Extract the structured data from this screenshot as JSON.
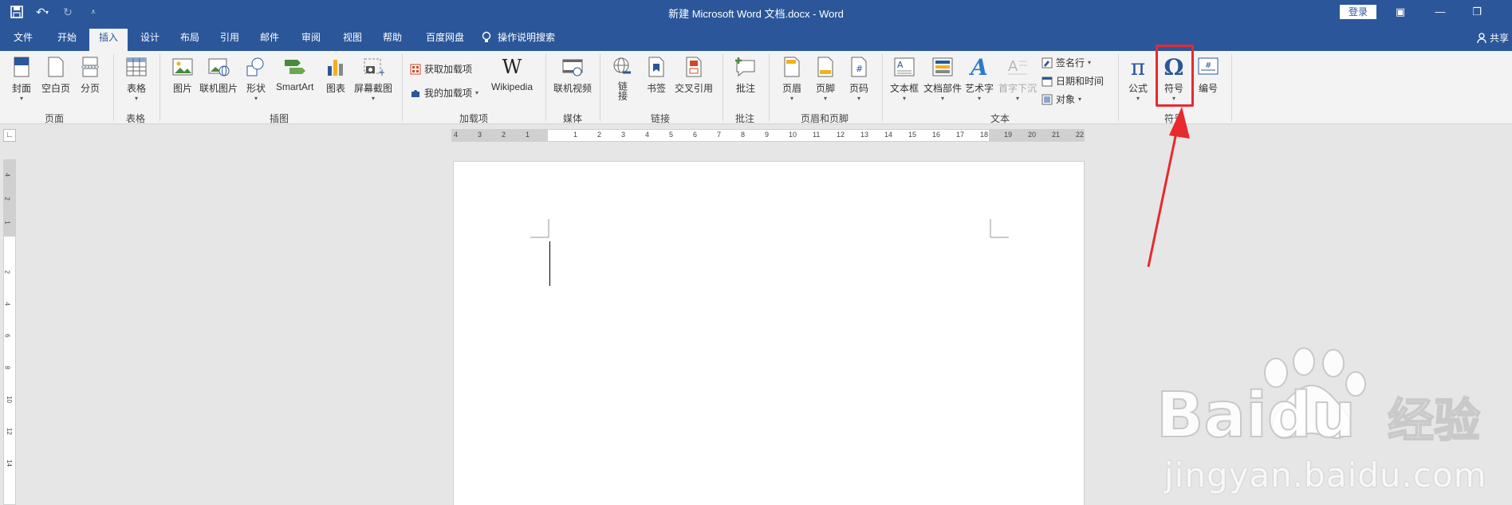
{
  "titlebar": {
    "title": "新建 Microsoft Word 文档.docx  -  Word",
    "login": "登录"
  },
  "tabs": [
    "文件",
    "开始",
    "插入",
    "设计",
    "布局",
    "引用",
    "邮件",
    "审阅",
    "视图",
    "帮助",
    "百度网盘"
  ],
  "active_tab": "插入",
  "tell_me": "操作说明搜索",
  "share": "共享",
  "ribbon": {
    "pages": {
      "cover": "封面",
      "blank": "空白页",
      "break": "分页",
      "group": "页面"
    },
    "tables": {
      "table": "表格",
      "group": "表格"
    },
    "illustrations": {
      "picture": "图片",
      "online_picture": "联机图片",
      "shapes": "形状",
      "smartart": "SmartArt",
      "chart": "图表",
      "screenshot": "屏幕截图",
      "group": "插图"
    },
    "addins": {
      "get": "获取加载项",
      "my": "我的加载项",
      "wikipedia": "Wikipedia",
      "group": "加载项"
    },
    "media": {
      "online_video": "联机视频",
      "group": "媒体"
    },
    "links": {
      "link": "链接",
      "bookmark": "书签",
      "cross_ref": "交叉引用",
      "group": "链接"
    },
    "comments": {
      "comment": "批注",
      "group": "批注"
    },
    "header_footer": {
      "header": "页眉",
      "footer": "页脚",
      "page_number": "页码",
      "group": "页眉和页脚"
    },
    "text": {
      "textbox": "文本框",
      "quick_parts": "文档部件",
      "wordart": "艺术字",
      "drop_cap": "首字下沉",
      "signature": "签名行",
      "datetime": "日期和时间",
      "object": "对象",
      "group": "文本"
    },
    "symbols": {
      "equation": "公式",
      "symbol": "符号",
      "numbering": "编号",
      "group": "符号"
    }
  },
  "ruler": {
    "h_numbers": [
      "4",
      "3",
      "2",
      "1",
      "",
      "1",
      "2",
      "3",
      "4",
      "5",
      "6",
      "7",
      "8",
      "9",
      "10",
      "11",
      "12",
      "13",
      "14",
      "15",
      "16",
      "17",
      "18",
      "19",
      "20",
      "21",
      "22"
    ],
    "v_numbers": [
      "4",
      "2",
      "1",
      "2",
      "4",
      "6",
      "8",
      "10",
      "12",
      "14"
    ]
  },
  "watermark": {
    "url": "jingyan.baidu.com",
    "brand": "Baidu",
    "product": "经验"
  },
  "colors": {
    "accent": "#2b579a",
    "annotation": "#e8292e"
  }
}
